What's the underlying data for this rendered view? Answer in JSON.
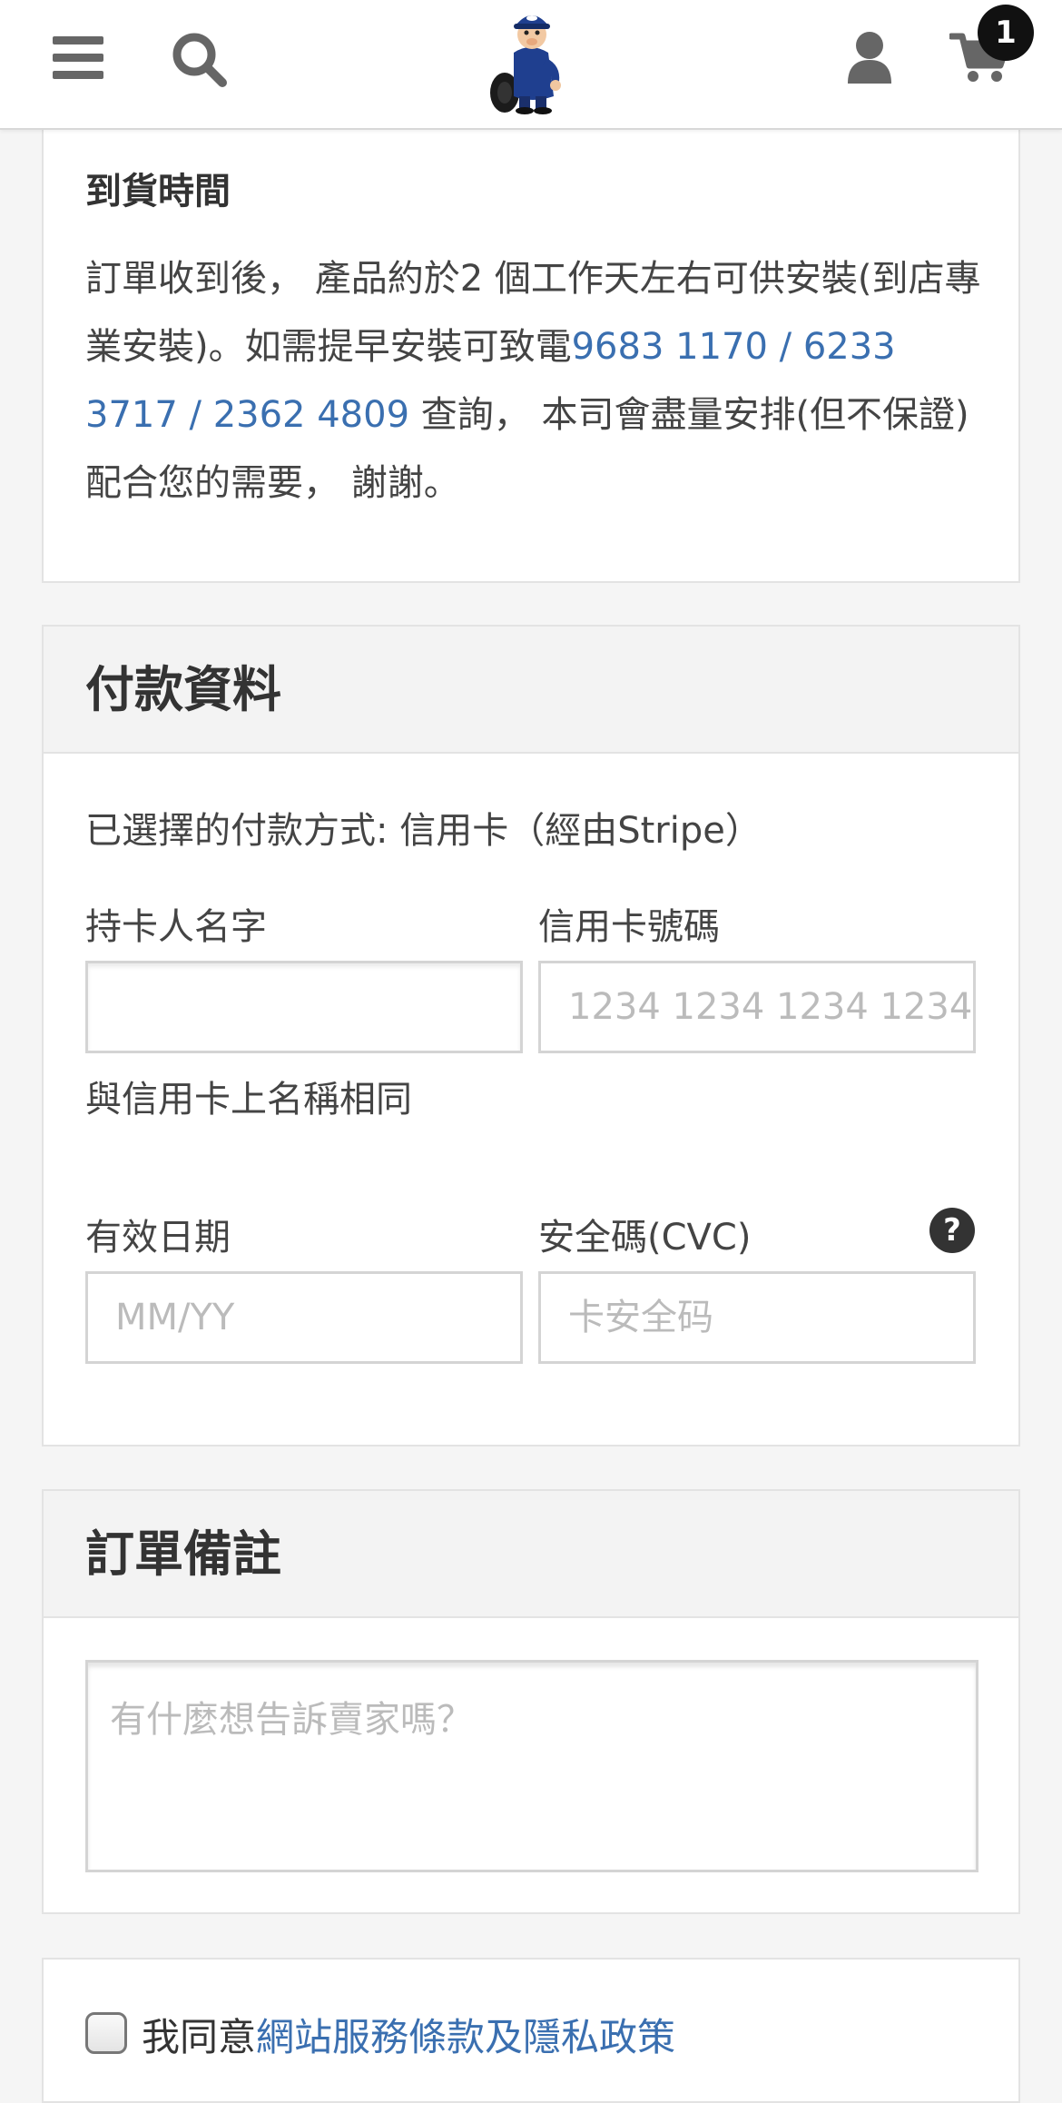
{
  "header": {
    "menu_icon": "hamburger-menu-icon",
    "search_icon": "search-icon",
    "logo_icon": "mechanic-mascot-logo",
    "user_icon": "user-icon",
    "cart_icon": "shopping-cart-icon",
    "cart_count": "1"
  },
  "delivery": {
    "title": "到貨時間",
    "text_1": "訂單收到後， 產品約於2 個工作天左右可供安裝(到店專業安裝)。如需提早安裝可致電",
    "phone_1": "9683 1170",
    "sep_1": " / ",
    "phone_2": "6233 3717",
    "sep_2": " / ",
    "phone_3": "2362 4809",
    "text_2": " 查詢， 本司會盡量安排(但不保證)配合您的需要， 謝謝。"
  },
  "payment": {
    "title": "付款資料",
    "method_text": "已選擇的付款方式: 信用卡（經由Stripe）",
    "cardholder_label": "持卡人名字",
    "cardholder_value": "",
    "cardholder_help": "與信用卡上名稱相同",
    "card_number_label": "信用卡號碼",
    "card_number_placeholder": "1234 1234 1234 1234",
    "expiry_label": "有效日期",
    "expiry_placeholder": "MM/YY",
    "cvc_label": "安全碼(CVC)",
    "cvc_placeholder": "卡安全码",
    "help_icon": "question-circle-icon"
  },
  "notes": {
    "title": "訂單備註",
    "placeholder": "有什麼想告訴賣家嗎？"
  },
  "agree": {
    "text": "我同意",
    "link_text": "網站服務條款及隱私政策"
  },
  "colors": {
    "link": "#3a6fb0",
    "icon_gray": "#666666",
    "badge": "#111111"
  }
}
